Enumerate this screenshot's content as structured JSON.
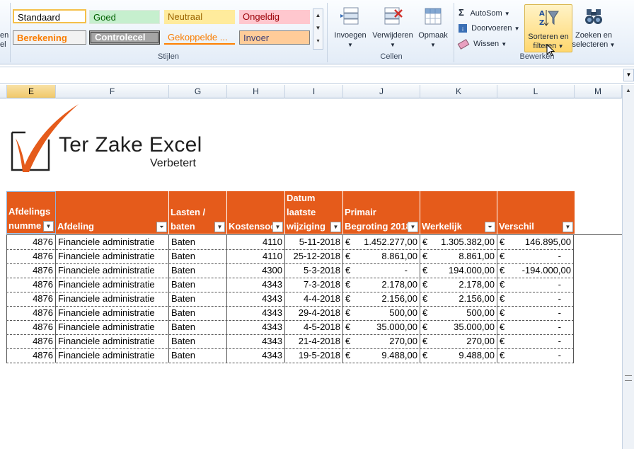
{
  "ribbon": {
    "styles": {
      "group_label": "Stijlen",
      "cells": {
        "standaard": "Standaard",
        "goed": "Goed",
        "neutraal": "Neutraal",
        "ongeldig": "Ongeldig",
        "berekening": "Berekening",
        "controlecel": "Controlecel",
        "gekoppelde": "Gekoppelde ...",
        "invoer": "Invoer"
      },
      "left_cut_top": "en",
      "left_cut_bottom": "el"
    },
    "cells_group": {
      "group_label": "Cellen",
      "invoegen": "Invoegen",
      "verwijderen": "Verwijderen",
      "opmaak": "Opmaak"
    },
    "edit_group": {
      "group_label": "Bewerken",
      "autosom": "AutoSom",
      "doorvoeren": "Doorvoeren",
      "wissen": "Wissen",
      "sorteren_line1": "Sorteren en",
      "sorteren_line2": "filteren",
      "zoeken_line1": "Zoeken en",
      "zoeken_line2": "selecteren"
    }
  },
  "columns": [
    "E",
    "F",
    "G",
    "H",
    "I",
    "J",
    "K",
    "L",
    "M"
  ],
  "logo": {
    "title": "Ter Zake Excel",
    "subtitle": "Verbetert"
  },
  "table": {
    "headers": {
      "afdnr": "Afdelings\nnumme",
      "afdeling": "Afdeling",
      "lasten": "Lasten /\nbaten",
      "kosten": "Kostensoo",
      "datum": "Datum\nlaatste\nwijziging",
      "begroting": "Primair\nBegroting 2018",
      "werkelijk": "Werkelijk",
      "verschil": "Verschil"
    },
    "currency": "€",
    "rows": [
      {
        "afdnr": "4876",
        "afdeling": "Financiele administratie",
        "lasten": "Baten",
        "kosten": "4110",
        "datum": "5-11-2018",
        "begroting": "1.452.277,00",
        "werkelijk": "1.305.382,00",
        "verschil": "146.895,00"
      },
      {
        "afdnr": "4876",
        "afdeling": "Financiele administratie",
        "lasten": "Baten",
        "kosten": "4110",
        "datum": "25-12-2018",
        "begroting": "8.861,00",
        "werkelijk": "8.861,00",
        "verschil": "-"
      },
      {
        "afdnr": "4876",
        "afdeling": "Financiele administratie",
        "lasten": "Baten",
        "kosten": "4300",
        "datum": "5-3-2018",
        "begroting": "-",
        "werkelijk": "194.000,00",
        "verschil": "-194.000,00"
      },
      {
        "afdnr": "4876",
        "afdeling": "Financiele administratie",
        "lasten": "Baten",
        "kosten": "4343",
        "datum": "7-3-2018",
        "begroting": "2.178,00",
        "werkelijk": "2.178,00",
        "verschil": "-"
      },
      {
        "afdnr": "4876",
        "afdeling": "Financiele administratie",
        "lasten": "Baten",
        "kosten": "4343",
        "datum": "4-4-2018",
        "begroting": "2.156,00",
        "werkelijk": "2.156,00",
        "verschil": "-"
      },
      {
        "afdnr": "4876",
        "afdeling": "Financiele administratie",
        "lasten": "Baten",
        "kosten": "4343",
        "datum": "29-4-2018",
        "begroting": "500,00",
        "werkelijk": "500,00",
        "verschil": "-"
      },
      {
        "afdnr": "4876",
        "afdeling": "Financiele administratie",
        "lasten": "Baten",
        "kosten": "4343",
        "datum": "4-5-2018",
        "begroting": "35.000,00",
        "werkelijk": "35.000,00",
        "verschil": "-"
      },
      {
        "afdnr": "4876",
        "afdeling": "Financiele administratie",
        "lasten": "Baten",
        "kosten": "4343",
        "datum": "21-4-2018",
        "begroting": "270,00",
        "werkelijk": "270,00",
        "verschil": "-"
      },
      {
        "afdnr": "4876",
        "afdeling": "Financiele administratie",
        "lasten": "Baten",
        "kosten": "4343",
        "datum": "19-5-2018",
        "begroting": "9.488,00",
        "werkelijk": "9.488,00",
        "verschil": "-"
      }
    ]
  },
  "colors": {
    "header_orange": "#e55b1b",
    "selected_column": "#f0c86a"
  }
}
